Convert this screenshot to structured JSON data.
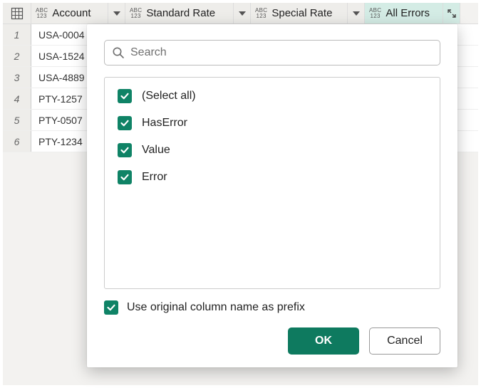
{
  "colors": {
    "accent": "#0f8366",
    "header_bg": "#eeedea",
    "active_header_bg": "#d4ece5"
  },
  "grid": {
    "type_badge": {
      "top": "ABC",
      "bottom": "123"
    },
    "columns": [
      {
        "name": "Account"
      },
      {
        "name": "Standard Rate"
      },
      {
        "name": "Special Rate"
      },
      {
        "name": "All Errors"
      }
    ],
    "rows": [
      {
        "index": "1",
        "account": "USA-0004"
      },
      {
        "index": "2",
        "account": "USA-1524"
      },
      {
        "index": "3",
        "account": "USA-4889"
      },
      {
        "index": "4",
        "account": "PTY-1257"
      },
      {
        "index": "5",
        "account": "PTY-0507"
      },
      {
        "index": "6",
        "account": "PTY-1234"
      }
    ]
  },
  "popup": {
    "search_placeholder": "Search",
    "options": [
      {
        "label": "(Select all)",
        "checked": true
      },
      {
        "label": "HasError",
        "checked": true
      },
      {
        "label": "Value",
        "checked": true
      },
      {
        "label": "Error",
        "checked": true
      }
    ],
    "prefix_label": "Use original column name as prefix",
    "prefix_checked": true,
    "ok_label": "OK",
    "cancel_label": "Cancel"
  }
}
